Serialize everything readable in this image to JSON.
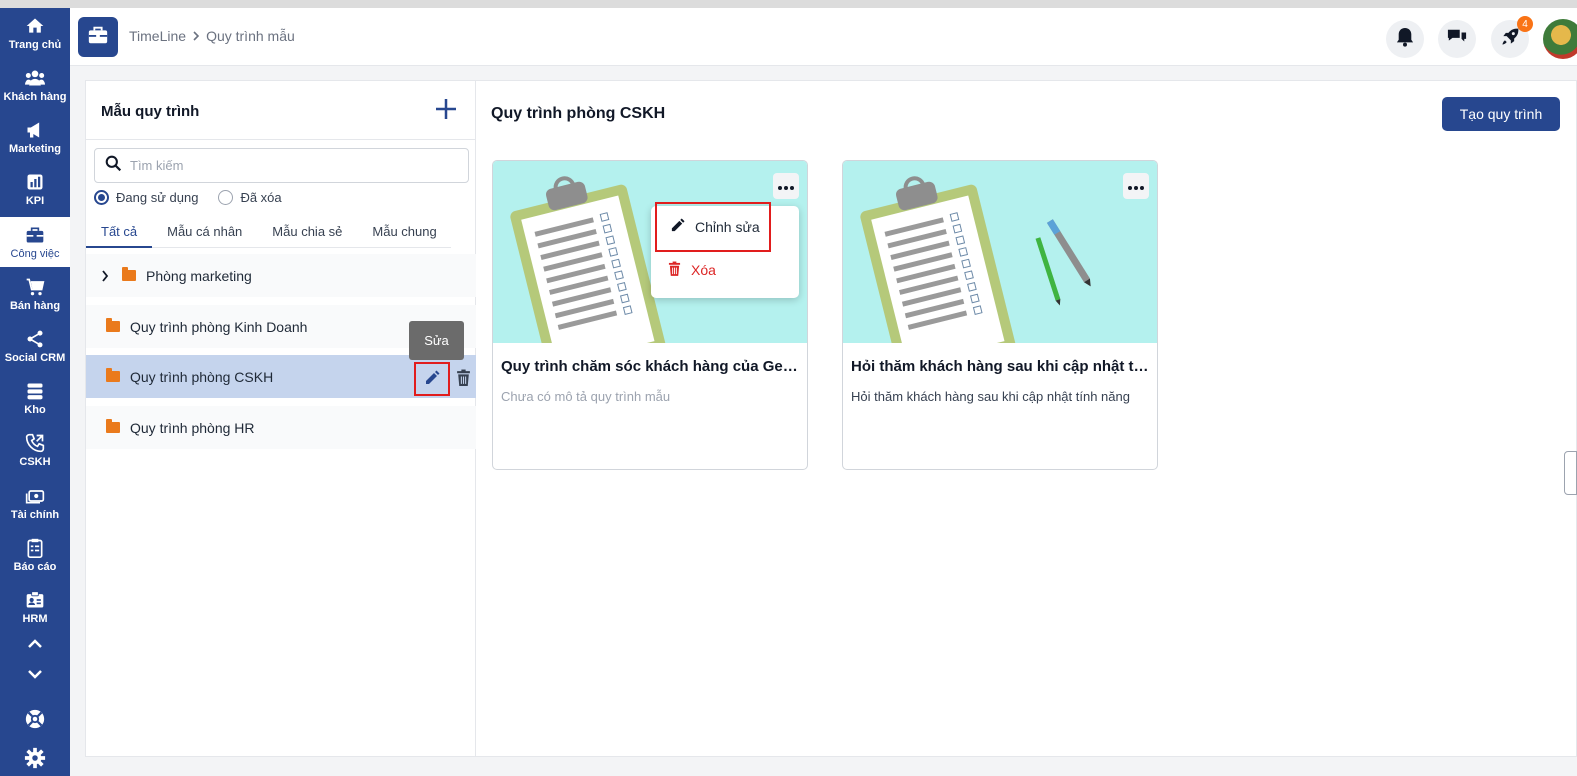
{
  "nav": {
    "items": [
      {
        "label": "Trang chủ",
        "icon": "home-icon"
      },
      {
        "label": "Khách hàng",
        "icon": "users-icon"
      },
      {
        "label": "Marketing",
        "icon": "megaphone-icon"
      },
      {
        "label": "KPI",
        "icon": "bar-chart-icon"
      },
      {
        "label": "Công việc",
        "icon": "briefcase-icon",
        "active": true
      },
      {
        "label": "Bán hàng",
        "icon": "cart-icon"
      },
      {
        "label": "Social CRM",
        "icon": "share-icon"
      },
      {
        "label": "Kho",
        "icon": "warehouse-icon"
      },
      {
        "label": "CSKH",
        "icon": "phone-icon"
      },
      {
        "label": "Tài chính",
        "icon": "money-icon"
      },
      {
        "label": "Báo cáo",
        "icon": "clipboard-icon"
      },
      {
        "label": "HRM",
        "icon": "id-card-icon"
      }
    ]
  },
  "header": {
    "breadcrumb": [
      "TimeLine",
      "Quy trình mẫu"
    ],
    "notification_badge": "4"
  },
  "left_panel": {
    "title": "Mẫu quy trình",
    "search_placeholder": "Tìm kiếm",
    "radios": [
      "Đang sử dụng",
      "Đã xóa"
    ],
    "tabs": [
      "Tất cả",
      "Mẫu cá nhân",
      "Mẫu chia sẻ",
      "Mẫu chung"
    ],
    "folders": [
      {
        "name": "Phòng marketing",
        "expandable": true
      },
      {
        "name": "Quy trình phòng Kinh Doanh"
      },
      {
        "name": "Quy trình phòng CSKH",
        "selected": true
      },
      {
        "name": "Quy trình phòng HR"
      }
    ],
    "tooltip": "Sửa"
  },
  "right_panel": {
    "title": "Quy trình phòng CSKH",
    "create_button": "Tạo quy trình",
    "templates": [
      {
        "name": "Quy trình chăm sóc khách hàng của GetFly",
        "description": "Chưa có mô tả quy trình mẫu",
        "desc_color": "#9ca3af"
      },
      {
        "name": "Hỏi thăm khách hàng sau khi cập nhật tính năng",
        "description": "Hỏi thăm khách hàng sau khi cập nhật tính năng",
        "desc_color": "#374151"
      }
    ],
    "context_menu": {
      "edit": "Chỉnh sửa",
      "delete": "Xóa"
    }
  },
  "colors": {
    "primary": "#27478f",
    "accent_orange": "#ea7a1c",
    "danger": "#dc2626",
    "card_bg": "#b4f1ee"
  }
}
